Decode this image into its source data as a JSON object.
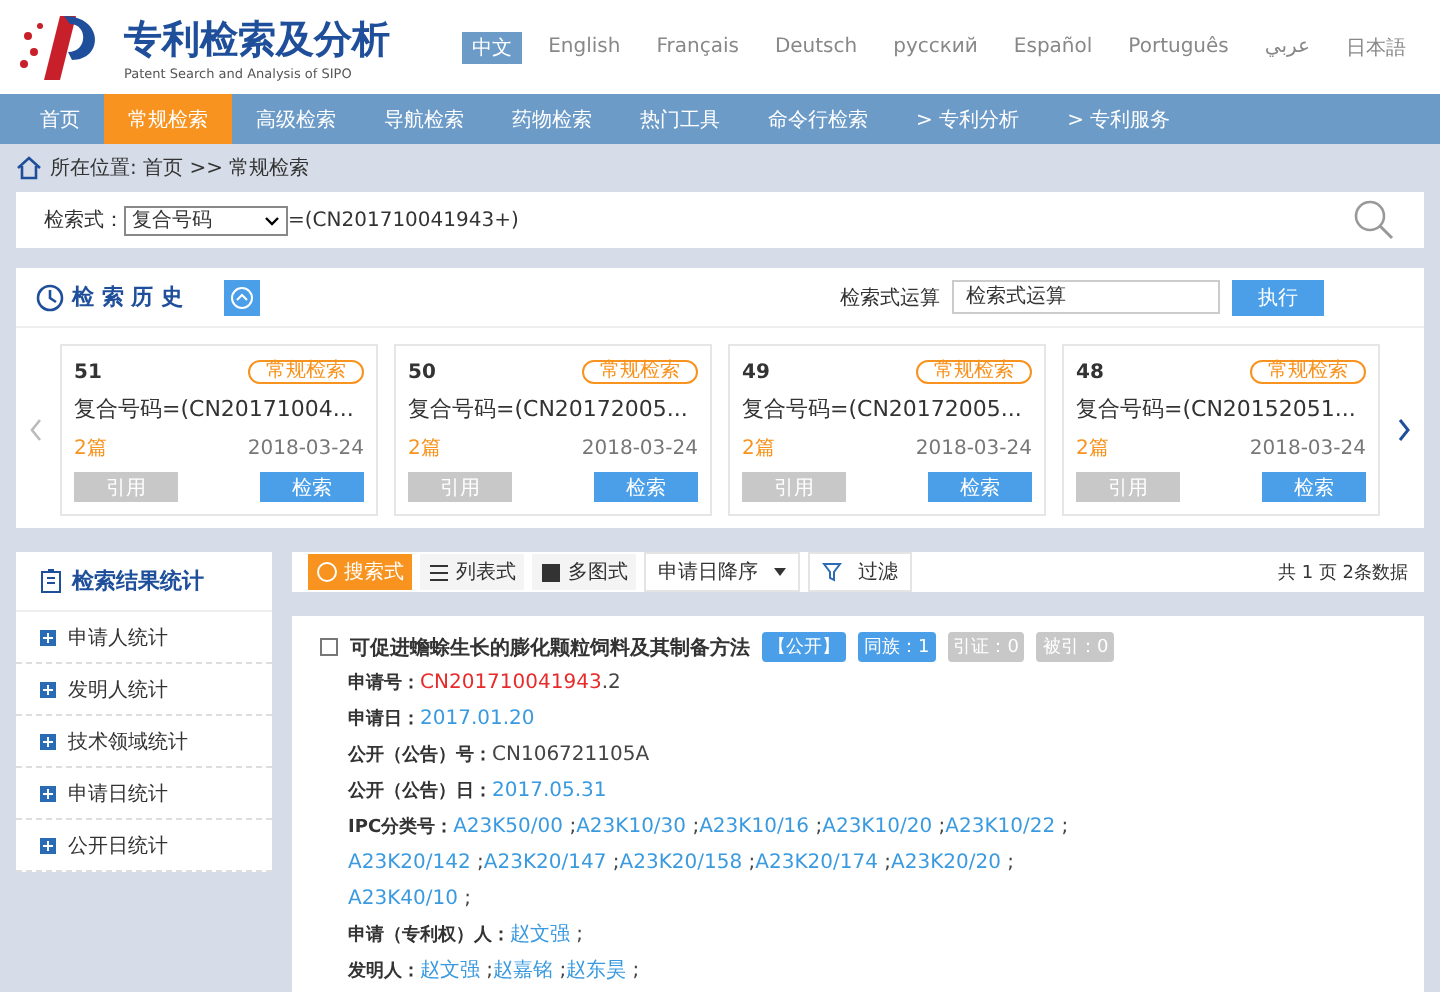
{
  "logo": {
    "title": "专利检索及分析",
    "subtitle": "Patent Search and Analysis of SIPO"
  },
  "languages": [
    {
      "label": "中文",
      "selected": true
    },
    {
      "label": "English",
      "selected": false
    },
    {
      "label": "Français",
      "selected": false
    },
    {
      "label": "Deutsch",
      "selected": false
    },
    {
      "label": "русский",
      "selected": false
    },
    {
      "label": "Español",
      "selected": false
    },
    {
      "label": "Português",
      "selected": false
    },
    {
      "label": "عربي",
      "selected": false
    },
    {
      "label": "日本語",
      "selected": false
    }
  ],
  "nav": [
    {
      "label": "首页",
      "selected": false
    },
    {
      "label": "常规检索",
      "selected": true
    },
    {
      "label": "高级检索",
      "selected": false
    },
    {
      "label": "导航检索",
      "selected": false
    },
    {
      "label": "药物检索",
      "selected": false
    },
    {
      "label": "热门工具",
      "selected": false
    },
    {
      "label": "命令行检索",
      "selected": false
    },
    {
      "label": "> 专利分析",
      "selected": false
    },
    {
      "label": "> 专利服务",
      "selected": false
    }
  ],
  "breadcrumb": "所在位置: 首页 >> 常规检索",
  "search": {
    "label": "检索式：",
    "field": "复合号码",
    "query": "=(CN201710041943+)"
  },
  "history": {
    "title": "检 索 历 史",
    "op_label": "检索式运算",
    "op_placeholder": "检索式运算",
    "run": "执行",
    "cards": [
      {
        "num": "51",
        "tag": "常规检索",
        "query": "复合号码=(CN20171004...",
        "count": "2篇",
        "date": "2018-03-24",
        "cite": "引用",
        "search": "检索"
      },
      {
        "num": "50",
        "tag": "常规检索",
        "query": "复合号码=(CN20172005...",
        "count": "2篇",
        "date": "2018-03-24",
        "cite": "引用",
        "search": "检索"
      },
      {
        "num": "49",
        "tag": "常规检索",
        "query": "复合号码=(CN20172005...",
        "count": "2篇",
        "date": "2018-03-24",
        "cite": "引用",
        "search": "检索"
      },
      {
        "num": "48",
        "tag": "常规检索",
        "query": "复合号码=(CN20152051...",
        "count": "2篇",
        "date": "2018-03-24",
        "cite": "引用",
        "search": "检索"
      }
    ]
  },
  "stats": {
    "title": "检索结果统计",
    "items": [
      "申请人统计",
      "发明人统计",
      "技术领域统计",
      "申请日统计",
      "公开日统计"
    ]
  },
  "toolbar": {
    "views": [
      {
        "label": "搜索式",
        "selected": true
      },
      {
        "label": "列表式",
        "selected": false
      },
      {
        "label": "多图式",
        "selected": false
      }
    ],
    "sort": "申请日降序",
    "filter": "过滤",
    "summary": "共 1 页 2条数据"
  },
  "result": {
    "checked": false,
    "title": "可促进蟾蜍生长的膨化颗粒饲料及其制备方法",
    "badges": [
      {
        "text": "【公开】",
        "active": true
      },
      {
        "text": "同族：1",
        "active": true
      },
      {
        "text": "引证：0",
        "active": false
      },
      {
        "text": "被引：0",
        "active": false
      }
    ],
    "fields": [
      {
        "label": "申请号：",
        "lines": [
          [
            {
              "text": "CN201710041943",
              "kind": "red"
            },
            {
              "text": ".2",
              "kind": "plain"
            }
          ]
        ]
      },
      {
        "label": "申请日：",
        "lines": [
          [
            {
              "text": "2017.01.20",
              "kind": "link"
            }
          ]
        ]
      },
      {
        "label": "公开（公告）号：",
        "lines": [
          [
            {
              "text": "CN106721105A",
              "kind": "plain"
            }
          ]
        ]
      },
      {
        "label": "公开（公告）日：",
        "lines": [
          [
            {
              "text": "2017.05.31",
              "kind": "link"
            }
          ]
        ]
      },
      {
        "label": "IPC分类号：",
        "lines": [
          [
            {
              "text": "A23K50/00",
              "kind": "link"
            },
            {
              "text": " ;",
              "kind": "plain"
            },
            {
              "text": "A23K10/30",
              "kind": "link"
            },
            {
              "text": " ;",
              "kind": "plain"
            },
            {
              "text": "A23K10/16",
              "kind": "link"
            },
            {
              "text": " ;",
              "kind": "plain"
            },
            {
              "text": "A23K10/20",
              "kind": "link"
            },
            {
              "text": " ;",
              "kind": "plain"
            },
            {
              "text": "A23K10/22",
              "kind": "link"
            },
            {
              "text": " ;",
              "kind": "plain"
            }
          ],
          [
            {
              "text": "A23K20/142",
              "kind": "link"
            },
            {
              "text": " ;",
              "kind": "plain"
            },
            {
              "text": "A23K20/147",
              "kind": "link"
            },
            {
              "text": " ;",
              "kind": "plain"
            },
            {
              "text": "A23K20/158",
              "kind": "link"
            },
            {
              "text": " ;",
              "kind": "plain"
            },
            {
              "text": "A23K20/174",
              "kind": "link"
            },
            {
              "text": " ;",
              "kind": "plain"
            },
            {
              "text": "A23K20/20",
              "kind": "link"
            },
            {
              "text": " ;",
              "kind": "plain"
            }
          ],
          [
            {
              "text": "A23K40/10",
              "kind": "link"
            },
            {
              "text": " ;",
              "kind": "plain"
            }
          ]
        ]
      },
      {
        "label": "申请（专利权）人：",
        "lines": [
          [
            {
              "text": "赵文强",
              "kind": "link"
            },
            {
              "text": " ;",
              "kind": "plain"
            }
          ]
        ]
      },
      {
        "label": "发明人：",
        "lines": [
          [
            {
              "text": "赵文强",
              "kind": "link"
            },
            {
              "text": " ;",
              "kind": "plain"
            },
            {
              "text": "赵嘉铭",
              "kind": "link"
            },
            {
              "text": " ;",
              "kind": "plain"
            },
            {
              "text": "赵东昊",
              "kind": "link"
            },
            {
              "text": " ;",
              "kind": "plain"
            }
          ]
        ]
      }
    ]
  }
}
